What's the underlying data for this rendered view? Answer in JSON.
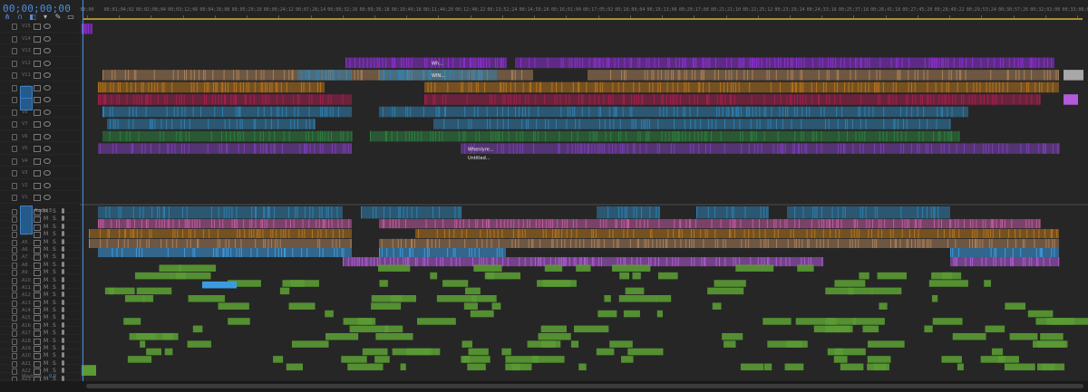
{
  "timecode": "00;00;00;00",
  "toolbar": {
    "icons": [
      "snap-icon",
      "linked-selection-icon",
      "add-marker-icon",
      "marker-icon",
      "wrench-icon",
      "captions-icon"
    ]
  },
  "ruler": {
    "labels": [
      "00;00",
      "00;01;04;02",
      "00;02;08;04",
      "00;03;12;06",
      "00;04;16;08",
      "00;05;20;10",
      "00;06;24;12",
      "00;07;28;14",
      "00;08;32;16",
      "00;09;36;18",
      "00;10;40;18",
      "00;11;44;20",
      "00;12;48;22",
      "00;13;52;24",
      "00;14;56;26",
      "00;16;01;00",
      "00;17;05;02",
      "00;18;09;04",
      "00;19;13;06",
      "00;20;17;08",
      "00;21;21;10",
      "00;22;25;12",
      "00;23;29;14",
      "00;24;33;16",
      "00;25;37;18",
      "00;26;41;18",
      "00;27;45;20",
      "00;28;49;22",
      "00;29;53;24",
      "00;30;57;26",
      "00;32;02;00",
      "00;33;06;02"
    ]
  },
  "video_tracks": [
    "V15",
    "V14",
    "V13",
    "V12",
    "V11",
    "V10",
    "V9",
    "V8",
    "V7",
    "V6",
    "V5",
    "V4",
    "V3",
    "V2",
    "V1"
  ],
  "audio_tracks": [
    "A1",
    "A2",
    "A3",
    "A4",
    "A5",
    "A6",
    "A7",
    "A8",
    "A9",
    "A10",
    "A11",
    "A12",
    "A13",
    "A14",
    "A15",
    "A16",
    "A17",
    "A18",
    "A19",
    "A20",
    "A21",
    "A22",
    "A23"
  ],
  "audio_track_label": "Audio 3",
  "master": {
    "label": "Mixdown",
    "value": "0.0"
  },
  "clip_labels": {
    "title_a": "Wh...",
    "title_b": "WIN...",
    "title_c": "Whenlyre...",
    "title_d": "Untitled..."
  },
  "colors": {
    "purple": "#8d2fd1",
    "violet": "#7b3fb4",
    "teal": "#2f7fb0",
    "orange": "#b7741e",
    "crimson": "#a3204e",
    "green": "#2d8040",
    "lime": "#5a9b34",
    "tan": "#a9805a",
    "blue_audio": "#3c9be0",
    "pink": "#c15aa0",
    "magenta": "#b25ad8",
    "accent": "#4a8fe0"
  }
}
